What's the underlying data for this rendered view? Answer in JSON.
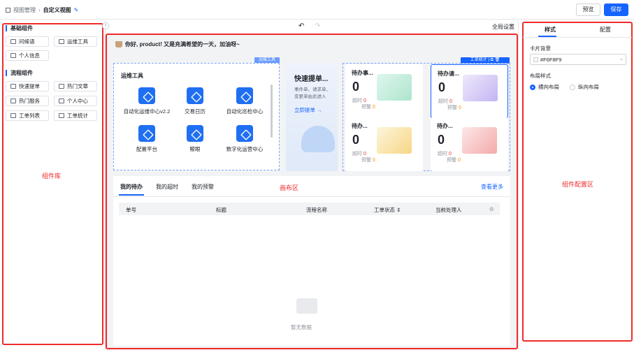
{
  "breadcrumb": {
    "root": "视图管理",
    "current": "自定义视图"
  },
  "header": {
    "preview": "预览",
    "save": "保存"
  },
  "left": {
    "group1": "基础组件",
    "group1_items": [
      "问候语",
      "运维工具",
      "个人信息"
    ],
    "group2": "流程组件",
    "group2_items": [
      "快速提单",
      "热门文章",
      "热门服务",
      "个人中心",
      "工单列表",
      "工单统计"
    ],
    "label": "组件库"
  },
  "toolbar": {
    "settings": "全局设置"
  },
  "canvas": {
    "greeting": "你好, product! 又是充满希望的一天，加油呀~",
    "ops_tag": "运维工具",
    "ops_title": "运维工具",
    "apps": [
      "自动化运维中心v2.2",
      "交易日历",
      "自动化巡检中心",
      "配置平台",
      "鲸眼",
      "数字化运营中心"
    ],
    "quick_title": "快速提单...",
    "quick_desc1": "事件单、请求单、",
    "quick_desc2": "变更单由此进入",
    "quick_link": "立即提单 →",
    "stats_tag": "工单统计 | ⧉ 🗑",
    "cards": [
      {
        "title": "待办事...",
        "num": "0",
        "timeout": "超时",
        "timeout_n": "0",
        "warn": "预警",
        "warn_n": "0"
      },
      {
        "title": "待办请...",
        "num": "0",
        "timeout": "超时",
        "timeout_n": "0",
        "warn": "预警",
        "warn_n": "0"
      },
      {
        "title": "待办...",
        "num": "0",
        "timeout": "超时",
        "timeout_n": "0",
        "warn": "预警",
        "warn_n": "0"
      },
      {
        "title": "待办...",
        "num": "0",
        "timeout": "超时",
        "timeout_n": "0",
        "warn": "预警",
        "warn_n": "0"
      }
    ],
    "label": "画布区",
    "tabs": [
      "我的待办",
      "我的超时",
      "我的预警"
    ],
    "more": "查看更多",
    "columns": [
      "单号",
      "标题",
      "流程名称",
      "工单状态 ⇕",
      "当前处理人"
    ],
    "empty": "暂无数据"
  },
  "right": {
    "tabs": [
      "样式",
      "配置"
    ],
    "bg_label": "卡片背景",
    "bg_value": "#F6F8F9",
    "layout_label": "布局样式",
    "layout_opts": [
      "横向布局",
      "纵向布局"
    ],
    "label": "组件配置区"
  },
  "colors": {
    "accent": "#1664ff",
    "red": "#ef2b2b"
  }
}
